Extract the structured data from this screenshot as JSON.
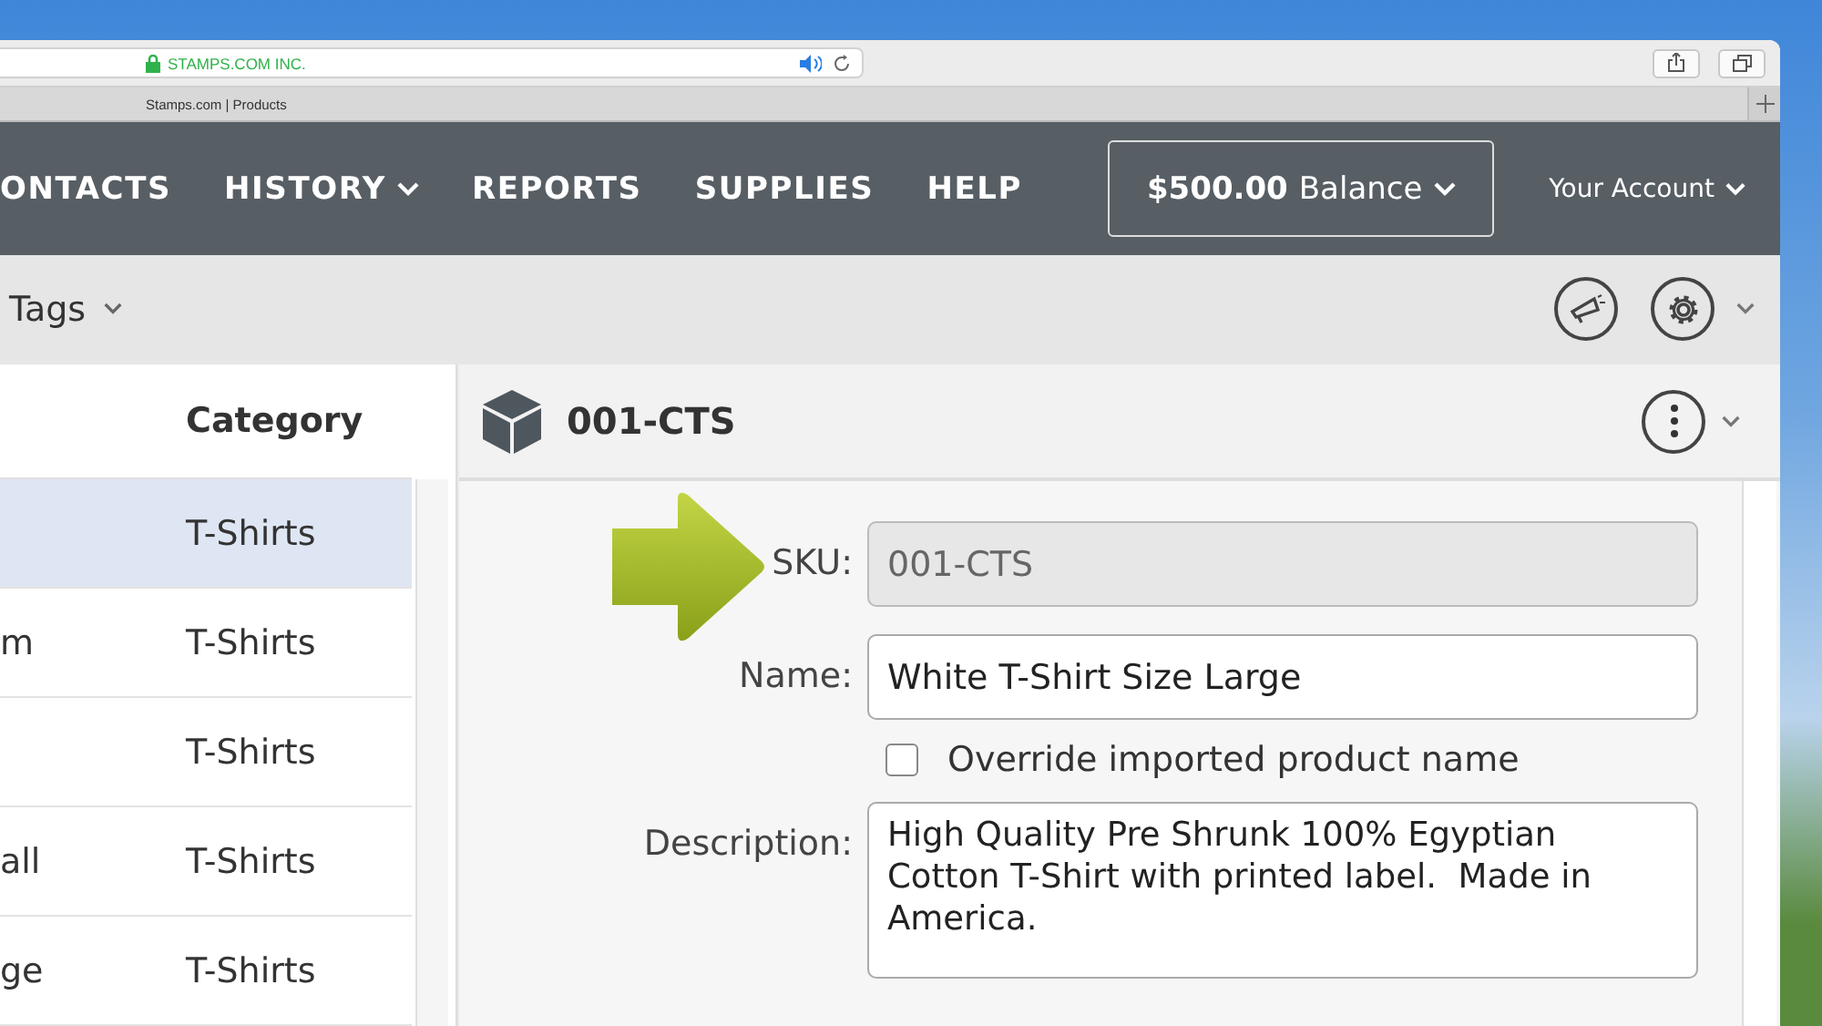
{
  "browser": {
    "address": "STAMPS.COM INC.",
    "tab_title": "Stamps.com | Products"
  },
  "nav": {
    "items": [
      {
        "label": "ONTACTS",
        "dropdown": false
      },
      {
        "label": "HISTORY",
        "dropdown": true
      },
      {
        "label": "REPORTS",
        "dropdown": false
      },
      {
        "label": "SUPPLIES",
        "dropdown": false
      },
      {
        "label": "HELP",
        "dropdown": false
      }
    ],
    "balance_amount": "$500.00",
    "balance_label": "Balance",
    "account": "Your Account"
  },
  "toolbar": {
    "tags": "Tags"
  },
  "table": {
    "columns": [
      "",
      "Category"
    ],
    "rows": [
      {
        "cells": [
          "",
          "T-Shirts"
        ],
        "selected": true
      },
      {
        "cells": [
          "m",
          "T-Shirts"
        ],
        "selected": false
      },
      {
        "cells": [
          "",
          "T-Shirts"
        ],
        "selected": false
      },
      {
        "cells": [
          "all",
          "T-Shirts"
        ],
        "selected": false
      },
      {
        "cells": [
          "ge",
          "T-Shirts"
        ],
        "selected": false
      }
    ]
  },
  "detail": {
    "title": "001-CTS",
    "fields": [
      {
        "kind": "input",
        "label": "SKU:",
        "value": "001-CTS",
        "disabled": true
      },
      {
        "kind": "input",
        "label": "Name:",
        "value": "White T-Shirt Size Large",
        "disabled": false
      },
      {
        "kind": "checkbox",
        "label": "Override imported product name",
        "checked": false
      },
      {
        "kind": "textarea",
        "label": "Description:",
        "value": "High Quality Pre Shrunk 100% Egyptian Cotton T-Shirt with printed label.  Made in America.",
        "disabled": false
      }
    ]
  }
}
